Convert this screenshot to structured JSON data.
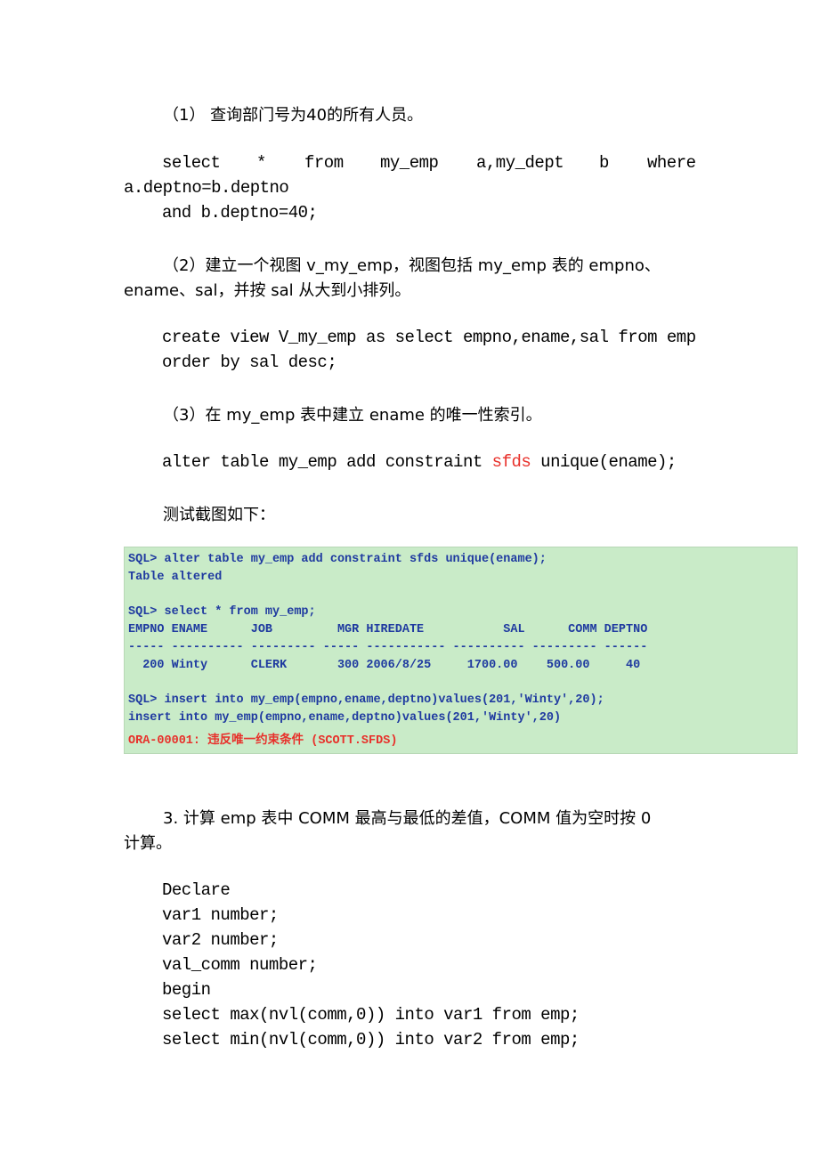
{
  "q1": {
    "heading": "（1） 查询部门号为40的所有人员。",
    "sql_line1_words": [
      "select",
      "*",
      "from",
      "my_emp",
      "a,my_dept",
      "b",
      "where"
    ],
    "sql_line2": "a.deptno=b.deptno",
    "sql_line3": "and b.deptno=40;"
  },
  "q2": {
    "heading_line1": "（2）建立一个视图 v_my_emp，视图包括 my_emp 表的 empno、",
    "heading_line2": "ename、sal，并按 sal 从大到小排列。",
    "sql_line1": "create view V_my_emp as select empno,ename,sal from emp",
    "sql_line2": "order by sal desc;"
  },
  "q3": {
    "heading": "（3）在 my_emp 表中建立 ename 的唯一性索引。",
    "sql_before": "alter table my_emp add constraint ",
    "sql_highlight": "sfds",
    "sql_after": " unique(ename);",
    "caption": "测试截图如下："
  },
  "terminal": {
    "lines": [
      "SQL> alter table my_emp add constraint sfds unique(ename);",
      "Table altered",
      "",
      "SQL> select * from my_emp;",
      "EMPNO ENAME      JOB         MGR HIREDATE           SAL      COMM DEPTNO",
      "----- ---------- --------- ----- ----------- ---------- --------- ------",
      "  200 Winty      CLERK       300 2006/8/25     1700.00    500.00     40",
      "",
      "SQL> insert into my_emp(empno,ename,deptno)values(201,'Winty',20);",
      "insert into my_emp(empno,ename,deptno)values(201,'Winty',20)"
    ],
    "error_line": "ORA-00001: 违反唯一约束条件 (SCOTT.SFDS)"
  },
  "q4": {
    "heading_line1": "3. 计算 emp 表中 COMM 最高与最低的差值，COMM 值为空时按 0",
    "heading_line2": "计算。",
    "code": [
      "Declare",
      "var1 number;",
      "var2 number;",
      "val_comm number;",
      "begin",
      "select max(nvl(comm,0)) into var1 from emp;",
      "select min(nvl(comm,0)) into var2 from emp;"
    ]
  }
}
